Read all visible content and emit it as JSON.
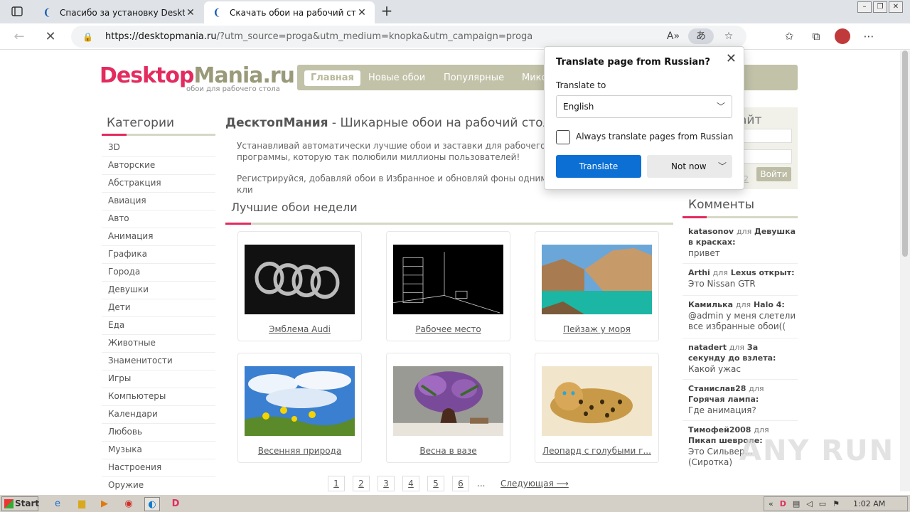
{
  "browser": {
    "tabs": [
      {
        "title": "Спасибо за установку DesktopMania",
        "active": false
      },
      {
        "title": "Скачать обои на рабочий стол",
        "active": true
      }
    ],
    "url_host": "https://desktopmania.ru",
    "url_rest": "/?utm_source=proga&utm_medium=knopka&utm_campaign=proga",
    "new_tab": "+"
  },
  "site": {
    "logo_main": "Desktop",
    "logo_accent": "Mania.ru",
    "logo_sub": "обои для рабочего стола",
    "menu": [
      "Главная",
      "Новые обои",
      "Популярные",
      "Мико"
    ],
    "categories_title": "Категории",
    "categories": [
      "3D",
      "Авторские",
      "Абстракция",
      "Авиация",
      "Авто",
      "Анимация",
      "Графика",
      "Города",
      "Девушки",
      "Дети",
      "Еда",
      "Животные",
      "Знаменитости",
      "Игры",
      "Компьютеры",
      "Календари",
      "Любовь",
      "Музыка",
      "Настроения",
      "Оружие"
    ],
    "headline_brand": "ДесктопМания",
    "headline_rest": " - Шикарные обои на рабочий стол в",
    "intro_p1": "Устанавливай автоматически лучшие обои и заставки для рабочего программы, которую так полюбили миллионы пользователей!",
    "intro_p2": "Регистрируйся, добавляй обои в Избранное и обновляй фоны одним кли",
    "best_title": "Лучшие обои недели",
    "wallpapers": [
      {
        "caption": "Эмблема Audi"
      },
      {
        "caption": "Рабочее место"
      },
      {
        "caption": "Пейзаж у моря"
      },
      {
        "caption": "Весенняя природа"
      },
      {
        "caption": "Весна в вазе"
      },
      {
        "caption": "Леопард с голубыми г..."
      }
    ],
    "pages": [
      "1",
      "2",
      "3",
      "4",
      "5",
      "6"
    ],
    "pager_dots": "...",
    "pager_next": "Следующая ⟶",
    "login_title": "айт",
    "login_button": "Войти",
    "login_num": "2",
    "comments_title": "Комменты",
    "comments": [
      {
        "user": "katasonov",
        "for": "для",
        "target": "Девушка в красках",
        "text": "привет"
      },
      {
        "user": "Arthi",
        "for": "для",
        "target": "Lexus открыт",
        "text": "Это Nissan GTR"
      },
      {
        "user": "Камилька",
        "for": "для",
        "target": "Halo 4",
        "text": "@admin у меня слетели все избранные обои(("
      },
      {
        "user": "natadert",
        "for": "для",
        "target": "За секунду до взлета",
        "text": "Какой ужас"
      },
      {
        "user": "Станислав28",
        "for": "для",
        "target": "Горячая лампа",
        "text": "Где анимация?"
      },
      {
        "user": "Тимофей2008",
        "for": "для",
        "target": "Пикап шевроле",
        "text": "Это Сильвер... (Сиротка)"
      }
    ],
    "watermark": "ANY RUN"
  },
  "translate_popup": {
    "title": "Translate page from Russian?",
    "translate_to_label": "Translate to",
    "language": "English",
    "always_label": "Always translate pages from Russian",
    "translate_button": "Translate",
    "not_now_button": "Not now"
  },
  "taskbar": {
    "start": "Start",
    "clock": "1:02 AM"
  },
  "colors": {
    "accent": "#e32b5f",
    "menu_bg": "#c2c2a9",
    "translate_blue": "#0b6fd4"
  }
}
